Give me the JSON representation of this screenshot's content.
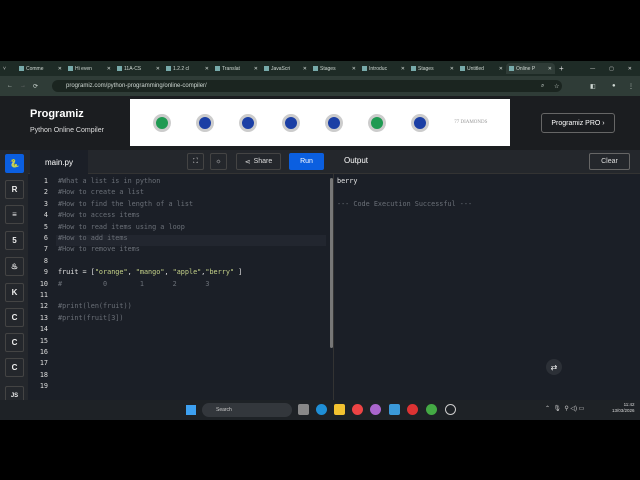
{
  "browser": {
    "tabs": [
      "Comme",
      "Hi even",
      "11A-CS",
      "1.2.2 cl",
      "Translat",
      "JavaScri",
      "Stages",
      "Introduc",
      "Stages",
      "Untitled",
      "Online P"
    ],
    "url": "programiz.com/python-programming/online-compiler/"
  },
  "header": {
    "logo": "Programiz",
    "subtitle": "Python Online Compiler",
    "ad_text": "77 DIAMONDS",
    "pro_button": "Programiz PRO ›"
  },
  "sidebar": {
    "items": [
      "python",
      "r",
      "sql",
      "html",
      "java",
      "kotlin",
      "c",
      "cpp",
      "csharp",
      "JS"
    ]
  },
  "toolbar": {
    "file": "main.py",
    "share": "Share",
    "run": "Run",
    "output": "Output",
    "clear": "Clear"
  },
  "editor": {
    "lines": [
      "#What a list is in python",
      "#How to create a list",
      "#How to find the length of a list",
      "#How to access items",
      "#How to read items using a loop",
      "#How to add items",
      "#How to remove items",
      "",
      "fruit = [\"orange\", \"mango\", \"apple\",\"berry\" ]",
      "#          0        1       2       3",
      "",
      "#print(len(fruit))",
      "#print(fruit[3])",
      "",
      "",
      "",
      "",
      "",
      ""
    ]
  },
  "output": {
    "lines": [
      "berry",
      "",
      "--- Code Execution Successful ---"
    ]
  },
  "taskbar": {
    "search": "Search",
    "time": "11:42",
    "date": "13/03/2026"
  }
}
